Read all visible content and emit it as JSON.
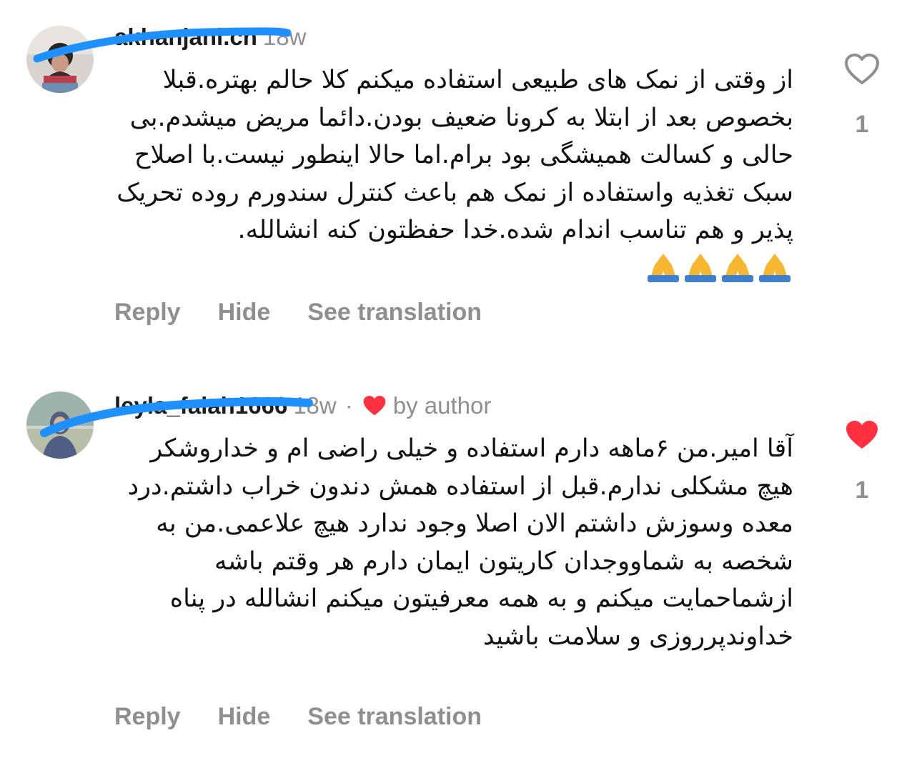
{
  "colors": {
    "liked_heart": "#ff3040",
    "meta_gray": "#8e8e93",
    "scribble_blue": "#1e90ff"
  },
  "comments": [
    {
      "username": "akhanjani.ch",
      "time": "18w",
      "text": "از وقتی از نمک های طبیعی استفاده میکنم کلا حالم بهتره.قبلا بخصوص بعد از ابتلا به کرونا ضعیف بودن.دائما مریض میشدم.بی حالی و کسالت همیشگی بود برام.اما حالا اینطور نیست.با اصلاح سبک تغذیه واستفاده از نمک هم باعث کنترل سندورم روده تحریک پذیر و هم تناسب اندام شده.خدا حفظتون کنه انشالله.",
      "emoji": [
        "folded-hands",
        "folded-hands",
        "folded-hands",
        "folded-hands"
      ],
      "actions": {
        "reply": "Reply",
        "hide": "Hide",
        "translate": "See translation"
      },
      "like_count": "1",
      "liked": false
    },
    {
      "username": "leyla_falah1666",
      "time": "18w",
      "dot": "·",
      "author_like": "by author",
      "text": "آقا امیر.من ۶ماهه دارم استفاده و خیلی راضی ام و خداروشکر هیچ مشکلی ندارم.قبل از استفاده همش دندون خراب داشتم.درد معده وسوزش داشتم الان اصلا وجود ندارد هیچ علاعمی.من به شخصه به شماووجدان کاریتون ایمان دارم هر وقتم باشه ازشماحمایت میکنم و به همه معرفیتون میکنم انشالله در پناه خداوندپرروزی و سلامت باشید",
      "actions": {
        "reply": "Reply",
        "hide": "Hide",
        "translate": "See translation"
      },
      "like_count": "1",
      "liked": true
    }
  ]
}
